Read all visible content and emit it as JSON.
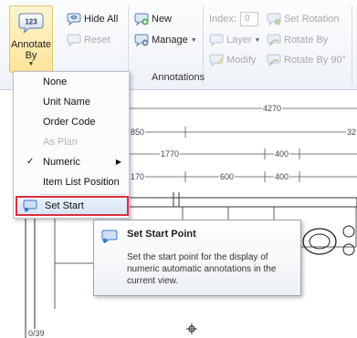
{
  "ribbon": {
    "annotate_by": {
      "line1": "Annotate",
      "line2": "By",
      "badge": "123"
    },
    "hide_all": "Hide All",
    "reset": "Reset",
    "new": "New",
    "manage": "Manage",
    "index_label": "Index:",
    "index_value": "0",
    "layer": "Layer",
    "modify": "Modify",
    "set_rotation": "Set Rotation",
    "rotate_by": "Rotate By",
    "rotate_by_90": "Rotate By 90°",
    "group_annotations": "Annotations"
  },
  "menu": {
    "none": "None",
    "unit_name": "Unit Name",
    "order_code": "Order Code",
    "as_plan": "As Plan",
    "numeric": "Numeric",
    "item_list_position": "Item List Position",
    "set_start": "Set Start"
  },
  "tooltip": {
    "title": "Set Start Point",
    "body": "Set the start point for the display of numeric automatic annotations in the current view."
  },
  "drawing": {
    "dim_4270": "4270",
    "dim_32": "32",
    "dim_850": "850",
    "dim_1770": "1770",
    "dim_400_a": "400",
    "dim_170": "170",
    "dim_600": "600",
    "dim_400_b": "400",
    "dim_bottom": "0/39"
  },
  "colors": {
    "highlight_border": "#d9303c",
    "accent": "#3a78c8"
  }
}
